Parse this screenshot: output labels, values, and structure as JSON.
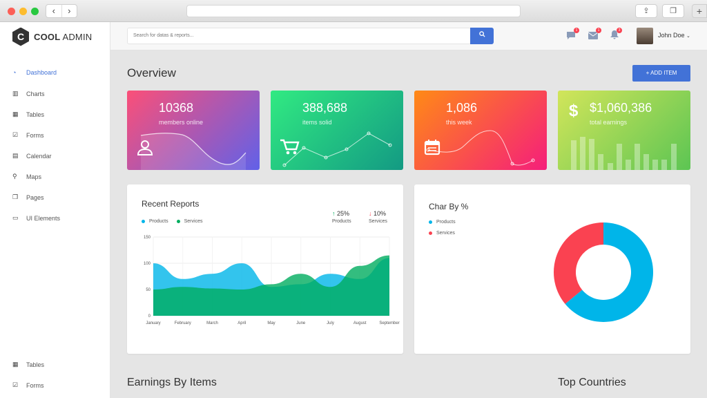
{
  "sidebar": {
    "logo_letter": "C",
    "logo_bold": "COOL",
    "logo_rest": "ADMIN",
    "items": [
      {
        "label": "Dashboard",
        "icon": "dashboard-icon"
      },
      {
        "label": "Charts",
        "icon": "bar-chart-icon"
      },
      {
        "label": "Tables",
        "icon": "table-icon"
      },
      {
        "label": "Forms",
        "icon": "checkbox-icon"
      },
      {
        "label": "Calendar",
        "icon": "calendar-icon"
      },
      {
        "label": "Maps",
        "icon": "map-marker-icon"
      },
      {
        "label": "Pages",
        "icon": "copy-icon"
      },
      {
        "label": "UI Elements",
        "icon": "desktop-icon"
      }
    ],
    "bottom_items": [
      {
        "label": "Tables",
        "icon": "table-icon"
      },
      {
        "label": "Forms",
        "icon": "checkbox-icon"
      }
    ]
  },
  "header": {
    "search_placeholder": "Search for datas & reports...",
    "badges": [
      "1",
      "1",
      "3"
    ],
    "user_name": "John Doe"
  },
  "main": {
    "title": "Overview",
    "add_button": "+ ADD ITEM",
    "cards": [
      {
        "value": "10368",
        "label": "members online",
        "icon": "user-icon"
      },
      {
        "value": "388,688",
        "label": "items solid",
        "icon": "cart-icon"
      },
      {
        "value": "1,086",
        "label": "this week",
        "icon": "calendar-icon"
      },
      {
        "value": "$1,060,386",
        "label": "total earnings",
        "icon": "dollar-icon"
      }
    ],
    "recent_reports": {
      "title": "Recent Reports",
      "legend": [
        "Products",
        "Services"
      ],
      "stats": [
        {
          "arrow": "↑",
          "pct": "25%",
          "label": "Products"
        },
        {
          "arrow": "↓",
          "pct": "10%",
          "label": "Services"
        }
      ]
    },
    "char_by": {
      "title": "Char By %",
      "legend": [
        "Products",
        "Services"
      ]
    },
    "earnings_title": "Earnings By Items",
    "countries_title": "Top Countries"
  },
  "colors": {
    "accent": "#4272d7",
    "products": "#00b5e9",
    "services": "#00ad5f",
    "pie_services": "#fa4251"
  },
  "chart_data": [
    {
      "type": "area",
      "title": "Recent Reports",
      "categories": [
        "January",
        "February",
        "March",
        "April",
        "May",
        "June",
        "July",
        "August",
        "September"
      ],
      "ylim": [
        0,
        150
      ],
      "yticks": [
        0,
        50,
        100,
        150
      ],
      "series": [
        {
          "name": "Products",
          "values": [
            100,
            70,
            80,
            100,
            55,
            60,
            80,
            70,
            110
          ]
        },
        {
          "name": "Services",
          "values": [
            50,
            55,
            52,
            50,
            60,
            80,
            55,
            95,
            115
          ]
        }
      ]
    },
    {
      "type": "pie",
      "title": "Char By %",
      "series": [
        {
          "name": "Products",
          "value": 64
        },
        {
          "name": "Services",
          "value": 36
        }
      ]
    }
  ]
}
